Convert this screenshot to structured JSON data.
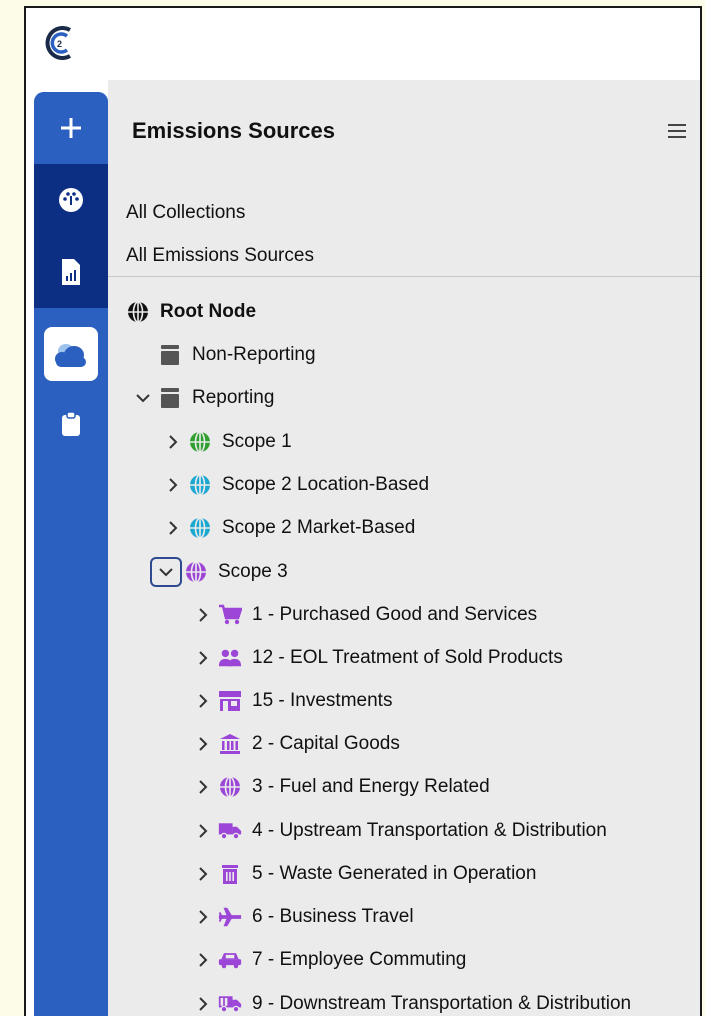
{
  "app": {
    "logo_name": "c2-logo"
  },
  "sidebar": {
    "items": [
      {
        "name": "add",
        "icon": "plus-icon"
      },
      {
        "name": "dashboard",
        "icon": "speedometer-icon"
      },
      {
        "name": "reports",
        "icon": "report-icon"
      },
      {
        "name": "emissions",
        "icon": "cloud-icon",
        "active": true
      },
      {
        "name": "tasks",
        "icon": "clipboard-icon"
      }
    ]
  },
  "panel": {
    "title": "Emissions Sources",
    "links": [
      "All Collections",
      "All Emissions Sources"
    ]
  },
  "tree": {
    "root": "Root Node",
    "non_reporting": "Non-Reporting",
    "reporting": "Reporting",
    "scopes": [
      "Scope 1",
      "Scope 2 Location-Based",
      "Scope 2 Market-Based",
      "Scope 3"
    ],
    "categories": [
      "1 - Purchased Good and Services",
      "12 - EOL Treatment of Sold Products",
      "15 - Investments",
      "2 - Capital Goods",
      "3 - Fuel and Energy Related",
      "4 - Upstream Transportation & Distribution",
      "5 - Waste Generated in Operation",
      "6 - Business Travel",
      "7 - Employee Commuting",
      "9 - Downstream Transportation & Distribution"
    ]
  },
  "colors": {
    "sidebar": "#2b5fc0",
    "sidebar_dark": "#0c2f84",
    "scope1": "#2e9e2e",
    "scope2": "#1ba7d0",
    "scope3": "#9b46d6",
    "db": "#555555"
  }
}
